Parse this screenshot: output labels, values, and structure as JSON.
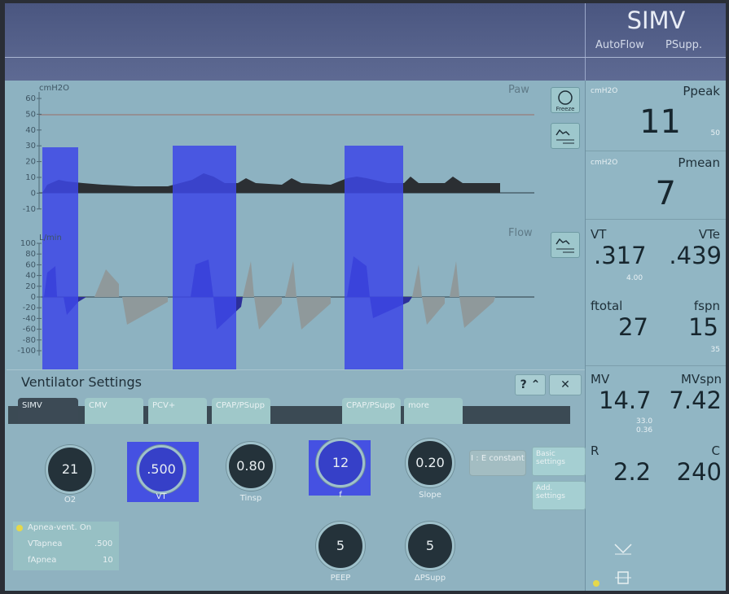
{
  "header": {
    "mode": "SIMV",
    "sub_left": "AutoFlow",
    "sub_right": "PSupp."
  },
  "waves": {
    "paw": {
      "name": "Paw",
      "unit": "cmH2O",
      "ticks": [
        "60",
        "50",
        "40",
        "30",
        "20",
        "10",
        "0",
        "-10"
      ]
    },
    "flow": {
      "name": "Flow",
      "unit": "L/min",
      "ticks": [
        "100",
        "80",
        "60",
        "40",
        "20",
        "0",
        "-20",
        "-40",
        "-60",
        "-80",
        "-100"
      ]
    },
    "freeze_label": "Freeze"
  },
  "measurements": {
    "ppeak": {
      "label": "Ppeak",
      "unit": "cmH2O",
      "value": "11",
      "limit": "50"
    },
    "pmean": {
      "label": "Pmean",
      "unit": "cmH2O",
      "value": "7"
    },
    "vt": {
      "label": "VT",
      "value": ".317",
      "limit": "4.00"
    },
    "vte": {
      "label": "VTe",
      "value": ".439"
    },
    "ftotal": {
      "label": "ftotal",
      "value": "27"
    },
    "fspn": {
      "label": "fspn",
      "value": "15",
      "limit": "35"
    },
    "mv": {
      "label": "MV",
      "value": "14.7",
      "limit_hi": "33.0",
      "limit_lo": "0.36"
    },
    "mvspn": {
      "label": "MVspn",
      "value": "7.42"
    },
    "r": {
      "label": "R",
      "value": "2.2"
    },
    "c": {
      "label": "C",
      "value": "240"
    }
  },
  "settings": {
    "title": "Ventilator Settings",
    "help": "?",
    "close": "✕",
    "tabs": [
      "SIMV",
      "CMV",
      "PCV+",
      "CPAP/PSupp",
      "CPAP/PSupp",
      "more"
    ],
    "knobs": [
      {
        "value": "21",
        "label": "O2"
      },
      {
        "value": ".500",
        "label": "VT"
      },
      {
        "value": "0.80",
        "label": "Tinsp"
      },
      {
        "value": "12",
        "label": "f"
      },
      {
        "value": "0.20",
        "label": "Slope"
      },
      {
        "value": "5",
        "label": "PEEP"
      },
      {
        "value": "5",
        "label": "ΔPSupp"
      }
    ],
    "ie_button": "I : E constant",
    "basic": "Basic settings",
    "add": "Add. settings",
    "apnea": {
      "title": "Apnea-vent. On",
      "vt_label": "VTapnea",
      "vt_value": ".500",
      "f_label": "fApnea",
      "f_value": "10"
    }
  },
  "colors": {
    "highlight": "#3d46e6",
    "header": "#4e5a85",
    "screen": "#8fb3c2"
  }
}
